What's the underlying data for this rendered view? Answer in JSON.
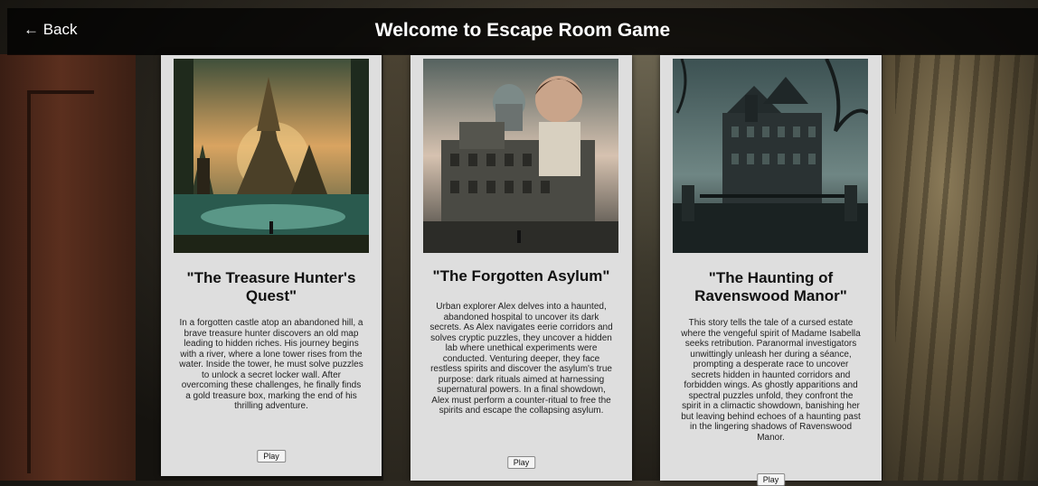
{
  "header": {
    "back_label": "← Back",
    "title": "Welcome to Escape Room Game"
  },
  "cards": [
    {
      "title": "\"The Treasure Hunter's Quest\"",
      "description": "In a forgotten castle atop an abandoned hill, a brave treasure hunter discovers an old map leading to hidden riches. His journey begins with a river, where a lone tower rises from the water. Inside the tower, he must solve puzzles to unlock a secret locker wall. After overcoming these challenges, he finally finds a gold treasure box, marking the end of his thrilling adventure.",
      "play_label": "Play"
    },
    {
      "title": "\"The Forgotten Asylum\"",
      "description": "Urban explorer Alex delves into a haunted, abandoned hospital to uncover its dark secrets. As Alex navigates eerie corridors and solves cryptic puzzles, they uncover a hidden lab where unethical experiments were conducted. Venturing deeper, they face restless spirits and discover the asylum's true purpose: dark rituals aimed at harnessing supernatural powers. In a final showdown, Alex must perform a counter-ritual to free the spirits and escape the collapsing asylum.",
      "play_label": "Play"
    },
    {
      "title": "\"The Haunting of Ravenswood Manor\"",
      "description": "This story tells the tale of a cursed estate where the vengeful spirit of Madame Isabella seeks retribution. Paranormal investigators unwittingly unleash her during a séance, prompting a desperate race to uncover secrets hidden in haunted corridors and forbidden wings. As ghostly apparitions and spectral puzzles unfold, they confront the spirit in a climactic showdown, banishing her but leaving behind echoes of a haunting past in the lingering shadows of Ravenswood Manor.",
      "play_label": "Play"
    }
  ],
  "icons": {
    "back": "arrow-left-icon"
  }
}
